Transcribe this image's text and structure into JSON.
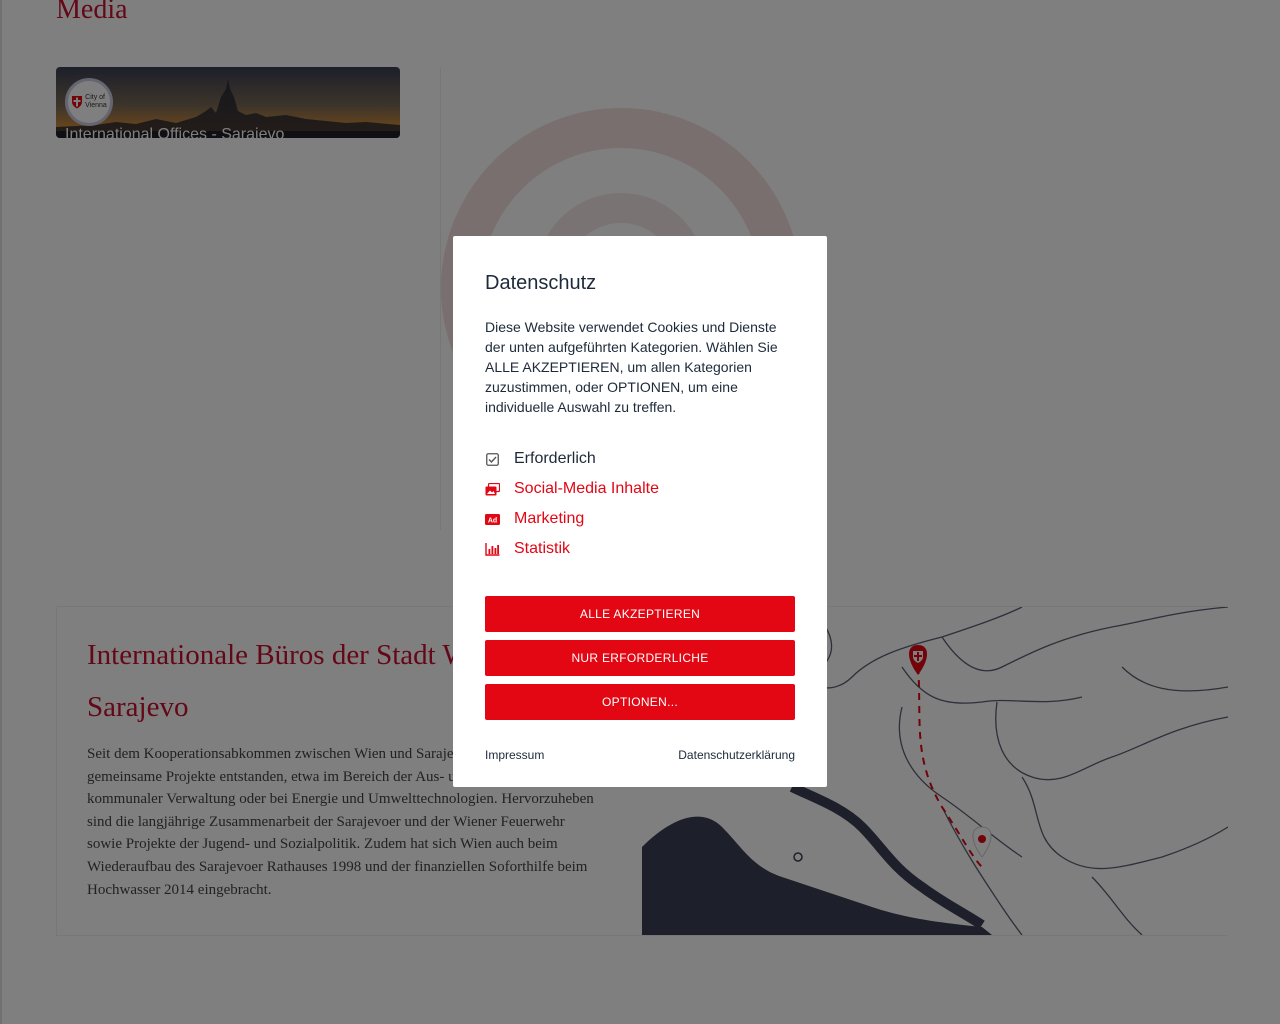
{
  "page": {
    "media_heading": "Media",
    "video": {
      "logo_line1": "City of",
      "logo_line2": "Vienna",
      "title": "International Offices - Sarajevo"
    },
    "info": {
      "title": "Internationale Büros der Stadt Wien",
      "subtitle": "Sarajevo",
      "text": "Seit dem Kooperationsabkommen zwischen Wien und Sarajevo sind viele gemeinsame Projekte entstanden, etwa im Bereich der Aus- und Aufbaus moderner kommunaler Verwaltung oder bei Energie und Umwelttechnologien. Hervorzuheben sind die langjährige Zusammenarbeit der Sarajevoer und der Wiener Feuerwehr sowie Projekte der Jugend- und Sozialpolitik. Zudem hat sich Wien auch beim Wiederaufbau des Sarajevoer Rathauses 1998 und der finanziellen Soforthilfe beim Hochwasser 2014 eingebracht."
    }
  },
  "modal": {
    "title": "Datenschutz",
    "description": "Diese Website verwendet Cookies und Dienste der unten aufgeführten Kategorien. Wählen Sie ALLE AKZEPTIEREN, um allen Kategorien zuzustimmen, oder OPTIONEN, um eine individuelle Auswahl zu treffen.",
    "categories": [
      {
        "label": "Erforderlich",
        "icon": "checkbox-checked-icon"
      },
      {
        "label": "Social-Media Inhalte",
        "icon": "images-icon"
      },
      {
        "label": "Marketing",
        "icon": "ad-icon"
      },
      {
        "label": "Statistik",
        "icon": "bar-chart-icon"
      }
    ],
    "buttons": {
      "accept_all": "ALLE AKZEPTIEREN",
      "required_only": "NUR ERFORDERLICHE",
      "options": "OPTIONEN..."
    },
    "links": {
      "impressum": "Impressum",
      "privacy": "Datenschutzerklärung"
    }
  },
  "colors": {
    "brand_red": "#e30613",
    "heading_red": "#c8102e",
    "text_dark": "#1d2a3a",
    "overlay": "rgba(0,0,0,0.5)"
  }
}
